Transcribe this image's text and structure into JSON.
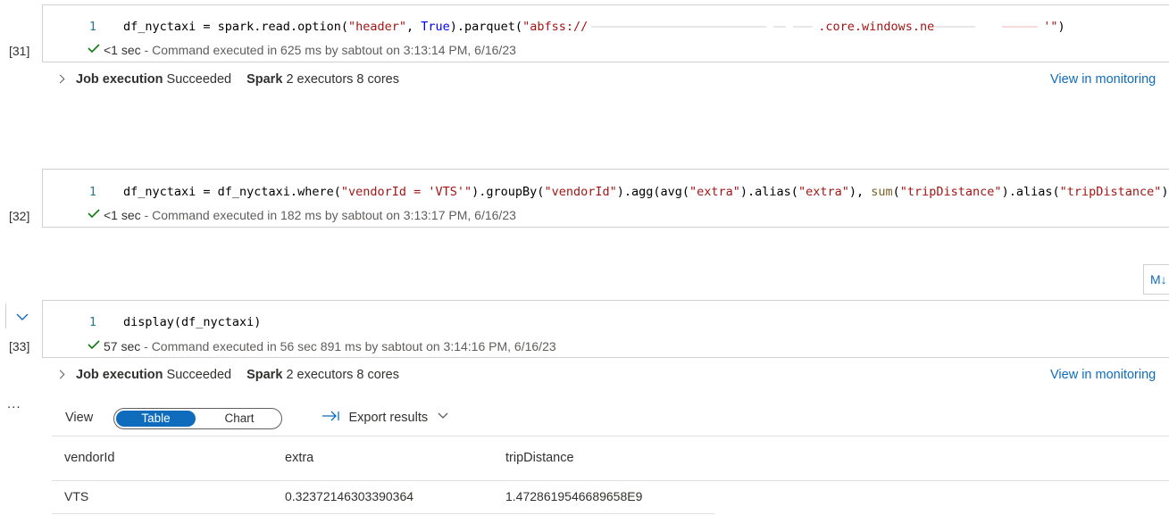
{
  "cells": [
    {
      "exec_count": "[31]",
      "line_number": "1",
      "code": {
        "p1": "df_nyctaxi = spark.read.option(",
        "p2": "\"header\"",
        "p3": ", ",
        "p4": "True",
        "p5": ").parquet(",
        "p6": "\"abfss://",
        "p7": ".core.windows.ne",
        "p8": "'\"",
        "p9": ")"
      },
      "status_duration": "<1 sec",
      "status_text": "- Command executed in 625 ms by sabtout on 3:13:14 PM, 6/16/23",
      "job": {
        "label": "Job execution",
        "state": "Succeeded",
        "spark_label": "Spark",
        "spark_info": "2 executors 8 cores"
      },
      "monitor_link": "View in monitoring"
    },
    {
      "exec_count": "[32]",
      "line_number": "1",
      "code": {
        "p1": "df_nyctaxi = df_nyctaxi.where(",
        "p2": "\"vendorId = 'VTS'\"",
        "p3": ").groupBy(",
        "p4": "\"vendorId\"",
        "p5": ").agg(avg(",
        "p6": "\"extra\"",
        "p7": ").alias(",
        "p8": "\"extra\"",
        "p9": "), ",
        "p10": "sum",
        "p11": "(",
        "p12": "\"tripDistance\"",
        "p13": ").alias(",
        "p14": "\"tripDistance\"",
        "p15": "))"
      },
      "status_duration": "<1 sec",
      "status_text": "- Command executed in 182 ms by sabtout on 3:13:17 PM, 6/16/23"
    },
    {
      "exec_count": "[33]",
      "line_number": "1",
      "code": {
        "p1": "display(df_nyctaxi)"
      },
      "status_duration": "57 sec",
      "status_text": "- Command executed in 56 sec 891 ms by sabtout on 3:14:16 PM, 6/16/23",
      "job": {
        "label": "Job execution",
        "state": "Succeeded",
        "spark_label": "Spark",
        "spark_info": "2 executors 8 cores"
      },
      "monitor_link": "View in monitoring"
    }
  ],
  "md_button": "M↓",
  "more_menu": "...",
  "results": {
    "view_label": "View",
    "toggle": {
      "table": "Table",
      "chart": "Chart",
      "selected": "Table"
    },
    "export_label": "Export results",
    "columns": [
      "vendorId",
      "extra",
      "tripDistance"
    ],
    "rows": [
      [
        "VTS",
        "0.32372146303390364",
        "1.4728619546689658E9"
      ]
    ]
  },
  "colors": {
    "accent": "#0f6cbd",
    "success": "#107c10",
    "border": "#d2d0ce"
  }
}
